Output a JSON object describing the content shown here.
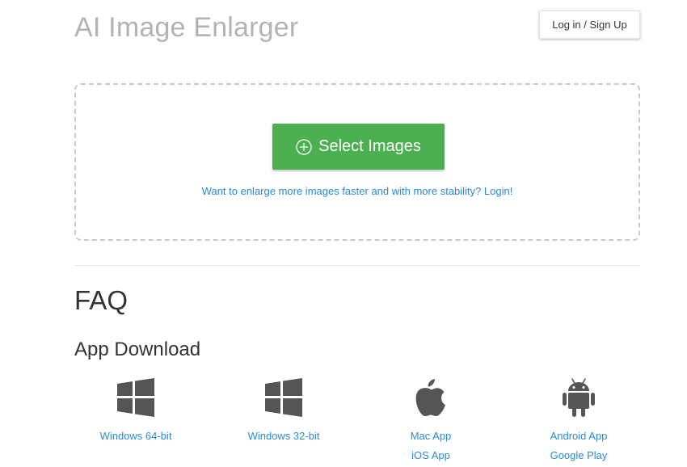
{
  "header": {
    "title": "AI Image Enlarger",
    "login_label": "Log in / Sign Up"
  },
  "upload": {
    "select_label": "Select Images",
    "login_prompt": "Want to enlarge more images faster and with more stability? Login!"
  },
  "faq": {
    "heading": "FAQ"
  },
  "app_download": {
    "heading": "App Download",
    "apps": [
      {
        "icon": "windows-icon",
        "links": [
          "Windows 64-bit"
        ]
      },
      {
        "icon": "windows-icon",
        "links": [
          "Windows 32-bit"
        ]
      },
      {
        "icon": "apple-icon",
        "links": [
          "Mac App",
          "iOS App"
        ]
      },
      {
        "icon": "android-icon",
        "links": [
          "Android App",
          "Google Play"
        ]
      }
    ]
  },
  "colors": {
    "accent_green": "#4caf50",
    "link_blue": "#2b8ad6",
    "title_gray": "#b3b3b3",
    "icon_gray": "#555555"
  }
}
